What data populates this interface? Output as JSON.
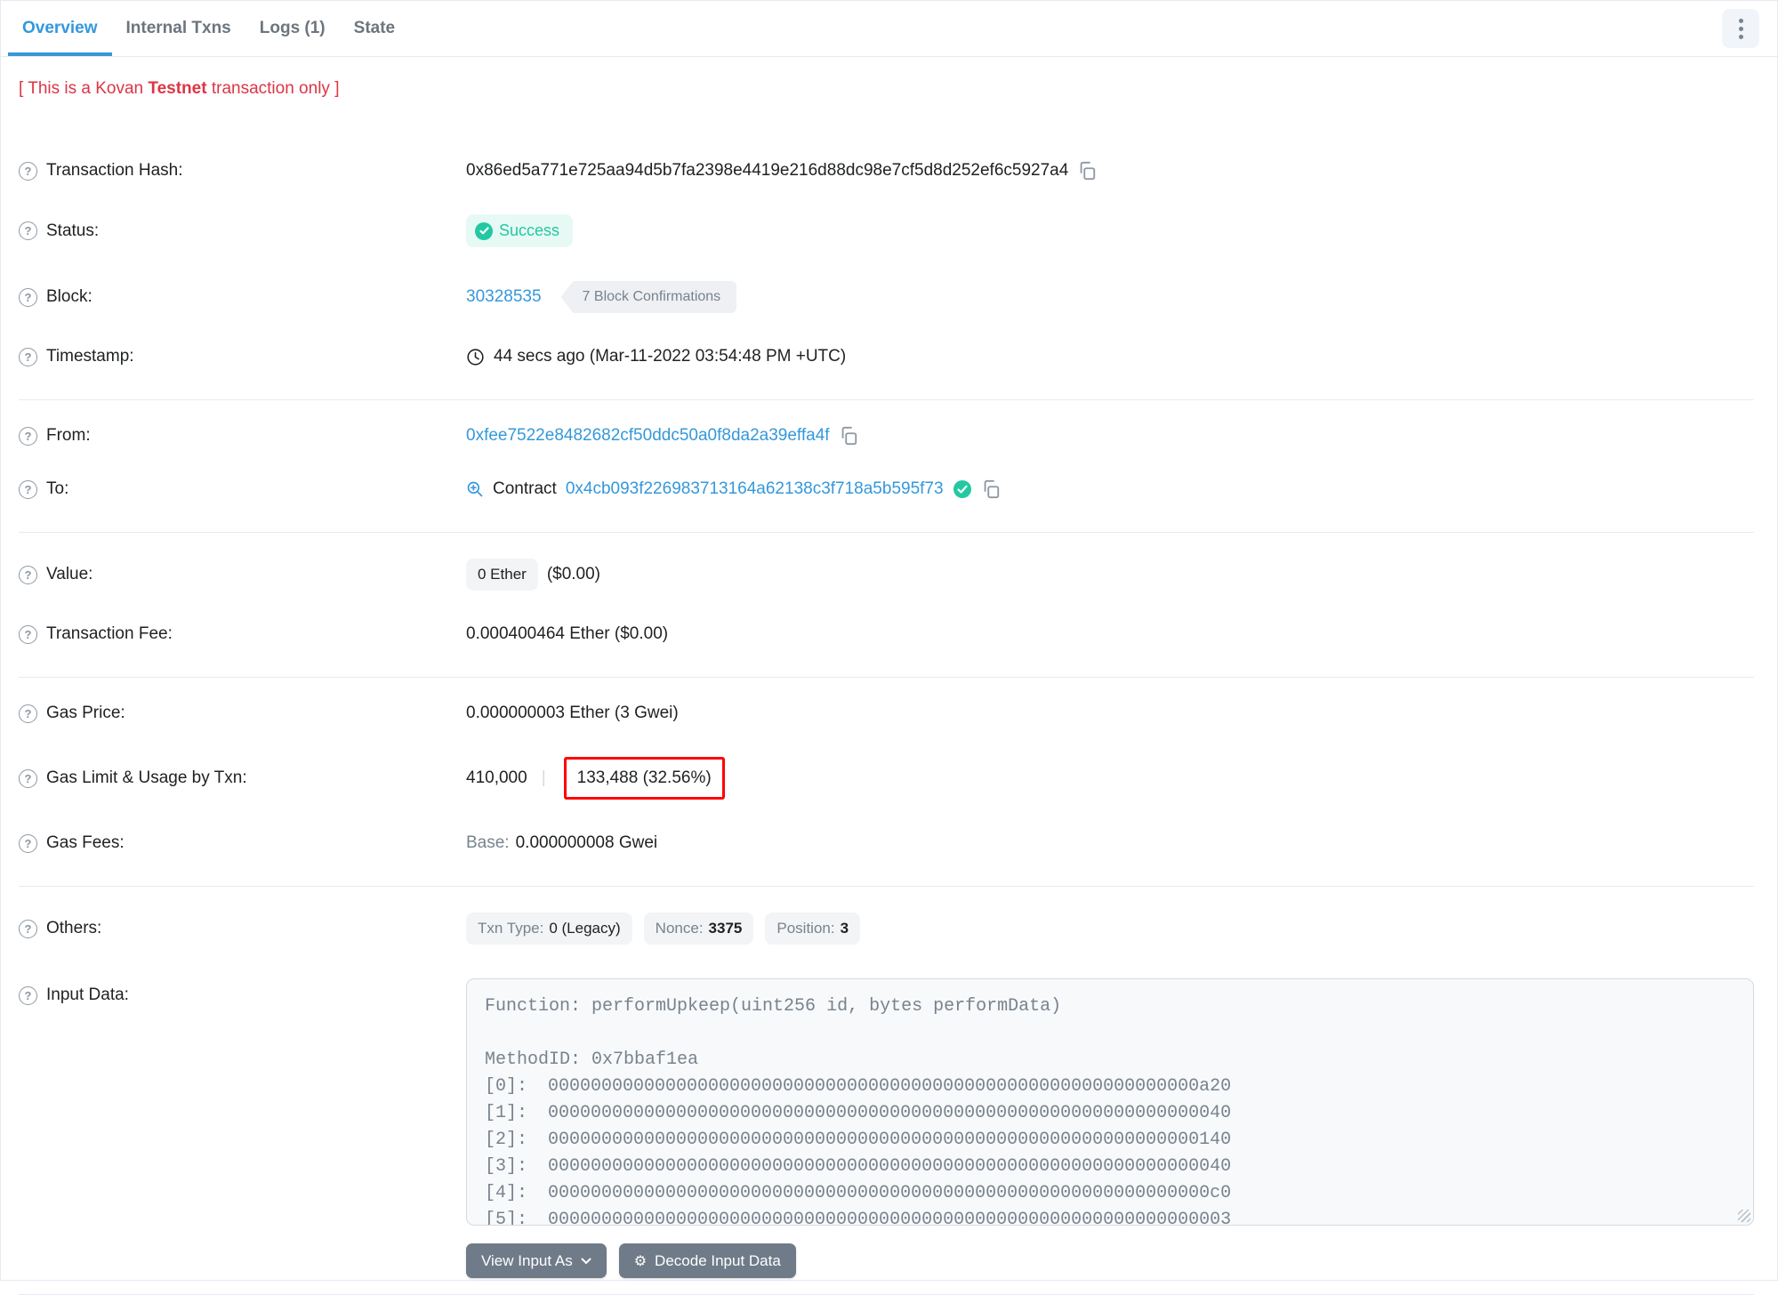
{
  "tabs": {
    "overview": "Overview",
    "internal_txns": "Internal Txns",
    "logs": "Logs (1)",
    "state": "State"
  },
  "banner": {
    "prefix": "[ This is a Kovan ",
    "bold": "Testnet",
    "suffix": " transaction only ]"
  },
  "rows": {
    "transaction_hash": {
      "label": "Transaction Hash:",
      "value": "0x86ed5a771e725aa94d5b7fa2398e4419e216d88dc98e7cf5d8d252ef6c5927a4"
    },
    "status": {
      "label": "Status:",
      "badge": "Success"
    },
    "block": {
      "label": "Block:",
      "number": "30328535",
      "confirmations": "7 Block Confirmations"
    },
    "timestamp": {
      "label": "Timestamp:",
      "value": "44 secs ago (Mar-11-2022 03:54:48 PM +UTC)"
    },
    "from": {
      "label": "From:",
      "address": "0xfee7522e8482682cf50ddc50a0f8da2a39effa4f"
    },
    "to": {
      "label": "To:",
      "type": "Contract",
      "address": "0x4cb093f226983713164a62138c3f718a5b595f73"
    },
    "value": {
      "label": "Value:",
      "amount": "0 Ether",
      "usd": "($0.00)"
    },
    "transaction_fee": {
      "label": "Transaction Fee:",
      "value": "0.000400464 Ether ($0.00)"
    },
    "gas_price": {
      "label": "Gas Price:",
      "value": "0.000000003 Ether (3 Gwei)"
    },
    "gas_limit_usage": {
      "label": "Gas Limit & Usage by Txn:",
      "limit": "410,000",
      "separator": "|",
      "usage": "133,488 (32.56%)"
    },
    "gas_fees": {
      "label": "Gas Fees:",
      "base_label": "Base:",
      "base_value": "0.000000008 Gwei"
    },
    "others": {
      "label": "Others:",
      "badges": [
        {
          "key": "Txn Type:",
          "value": "0 (Legacy)"
        },
        {
          "key": "Nonce:",
          "value": "3375"
        },
        {
          "key": "Position:",
          "value": "3"
        }
      ]
    },
    "input_data": {
      "label": "Input Data:"
    }
  },
  "input_data": {
    "function_line": "Function: performUpkeep(uint256 id, bytes performData)",
    "method_line": "MethodID: 0x7bbaf1ea",
    "params": [
      {
        "index": "[0]:",
        "value": "0000000000000000000000000000000000000000000000000000000000000a20"
      },
      {
        "index": "[1]:",
        "value": "0000000000000000000000000000000000000000000000000000000000000040"
      },
      {
        "index": "[2]:",
        "value": "0000000000000000000000000000000000000000000000000000000000000140"
      },
      {
        "index": "[3]:",
        "value": "0000000000000000000000000000000000000000000000000000000000000040"
      },
      {
        "index": "[4]:",
        "value": "00000000000000000000000000000000000000000000000000000000000000c0"
      },
      {
        "index": "[5]:",
        "value": "0000000000000000000000000000000000000000000000000000000000000003"
      }
    ]
  },
  "buttons": {
    "view_input_as": "View Input As",
    "decode_input_data": "Decode Input Data",
    "decode_icon_glyph": "⚙"
  },
  "icons": {
    "help": "question-circle",
    "copy": "copy",
    "clock": "clock",
    "zoom_in": "magnifier-plus",
    "verified": "check-circle",
    "caret": "chevron-down",
    "more": "kebab-menu"
  },
  "colors": {
    "accent_blue": "#3498db",
    "success_teal": "#23c8a2",
    "danger_red": "#dc3545",
    "annotation_red": "#ff0000",
    "text_dark": "#1e2022",
    "text_muted": "#77838f",
    "border": "#e7eaf3"
  }
}
